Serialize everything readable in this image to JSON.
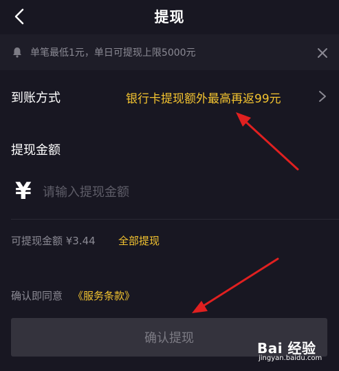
{
  "header": {
    "title": "提现"
  },
  "notice": {
    "text": "单笔最低1元，单日可提现上限5000元"
  },
  "method": {
    "label": "到账方式",
    "value": "银行卡提现额外最高再返99元"
  },
  "amount": {
    "label": "提现金额",
    "currency": "¥",
    "placeholder": "请输入提现金额"
  },
  "available": {
    "text": "可提现金额 ¥3.44",
    "withdraw_all": "全部提现"
  },
  "agreement": {
    "prefix": "确认即同意",
    "terms": "《服务条款》"
  },
  "confirm": {
    "label": "确认提现"
  },
  "watermark": {
    "logo": "Bai 经验",
    "url": "jingyan.baidu.com"
  },
  "colors": {
    "background": "#181722",
    "accent": "#f4c430",
    "annotation_arrow": "#e02020",
    "button_bg": "#34333d"
  }
}
